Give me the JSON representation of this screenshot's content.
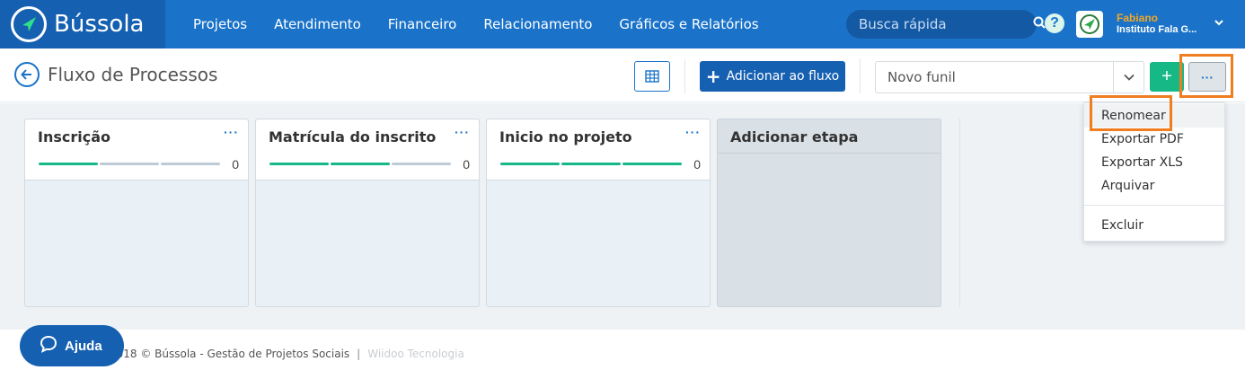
{
  "brand": {
    "name": "Bússola"
  },
  "nav": {
    "items": [
      "Projetos",
      "Atendimento",
      "Financeiro",
      "Relacionamento",
      "Gráficos e Relatórios"
    ]
  },
  "search": {
    "placeholder": "Busca rápida"
  },
  "user": {
    "name": "Fabiano",
    "org": "Instituto Fala G..."
  },
  "page": {
    "title": "Fluxo de Processos"
  },
  "toolbar": {
    "add_flow_label": "Adicionar ao fluxo",
    "funnel_value": "Novo funil",
    "plus_label": "+",
    "more_label": "···"
  },
  "stages": [
    {
      "title": "Inscrição",
      "count": "0",
      "progress_filled_segments": 1,
      "total_segments": 3
    },
    {
      "title": "Matrícula do inscrito",
      "count": "0",
      "progress_filled_segments": 2,
      "total_segments": 3
    },
    {
      "title": "Inicio no projeto",
      "count": "0",
      "progress_filled_segments": 3,
      "total_segments": 3
    }
  ],
  "add_stage": {
    "title": "Adicionar etapa"
  },
  "dropdown": {
    "items": [
      "Renomear",
      "Exportar PDF",
      "Exportar XLS",
      "Arquivar",
      "Excluir"
    ]
  },
  "footer": {
    "copyright": "2018 © Bússola - Gestão de Projetos Sociais",
    "separator": "|",
    "developer": "Wiidoo Tecnologia"
  },
  "help_chat": {
    "label": "Ajuda"
  },
  "colors": {
    "primary": "#1a73c9",
    "brand_dark": "#1560b0",
    "accent_green": "#16b886",
    "highlight": "#f07d1f",
    "user_name": "#f5a623"
  }
}
